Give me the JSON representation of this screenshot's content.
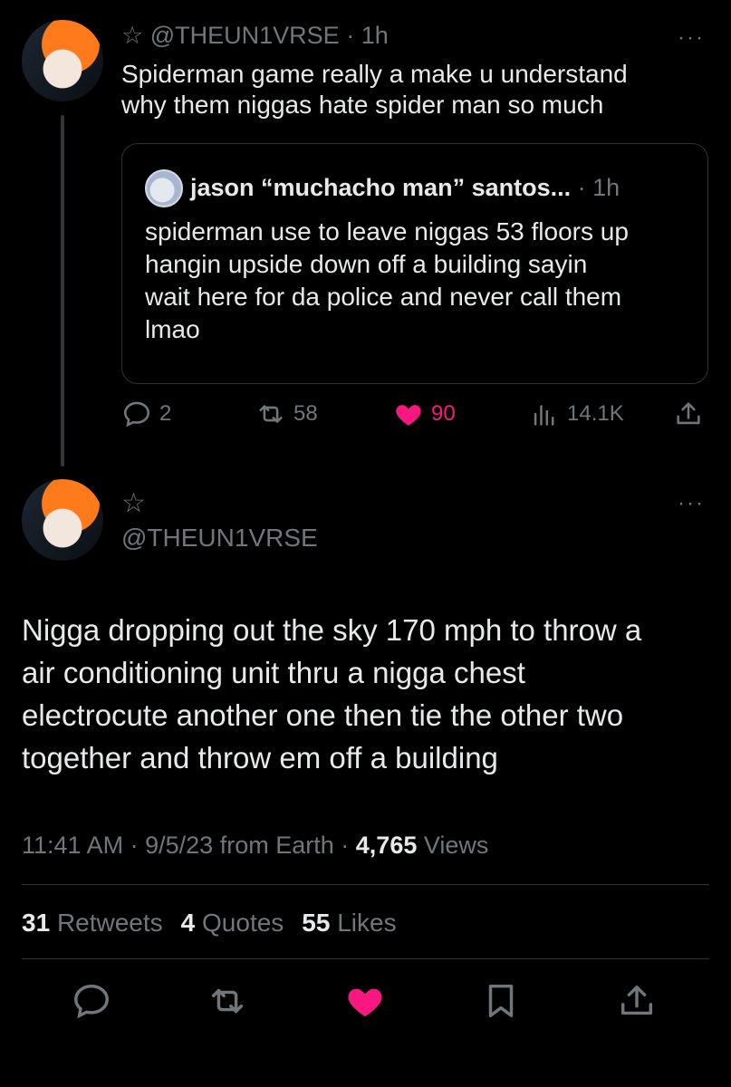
{
  "tweet1": {
    "star": "☆",
    "handle": "@THEUN1VRSE",
    "separator": "·",
    "time": "1h",
    "more": "···",
    "text_line1": "Spiderman game really a make u understand",
    "text_line2": "why them niggas hate spider man so much",
    "quote": {
      "name": "jason “muchacho man” santos...",
      "separator": "·",
      "time": "1h",
      "lines": [
        "spiderman use to leave niggas 53 floors up",
        "hangin upside down off a building sayin",
        "wait here for da police and never call them",
        "lmao"
      ]
    },
    "actions": {
      "replies": "2",
      "retweets": "58",
      "likes": "90",
      "views": "14.1K"
    }
  },
  "tweet2": {
    "star": "☆",
    "handle": "@THEUN1VRSE",
    "more": "···",
    "lines": [
      "Nigga dropping out the sky 170 mph to throw a",
      "air conditioning unit thru a nigga chest",
      "electrocute another one then tie the other two",
      "together and throw em off a building"
    ],
    "meta": {
      "time": "11:41 AM",
      "sep1": "·",
      "date": "9/5/23",
      "source": "from Earth",
      "sep2": "·",
      "views_count": "4,765",
      "views_label": "Views"
    },
    "stats": {
      "retweets_count": "31",
      "retweets_label": "Retweets",
      "quotes_count": "4",
      "quotes_label": "Quotes",
      "likes_count": "55",
      "likes_label": "Likes"
    }
  },
  "colors": {
    "background": "#000000",
    "text": "#e7e9ea",
    "muted": "#71767b",
    "like": "#f91880",
    "divider": "#2f3336"
  }
}
